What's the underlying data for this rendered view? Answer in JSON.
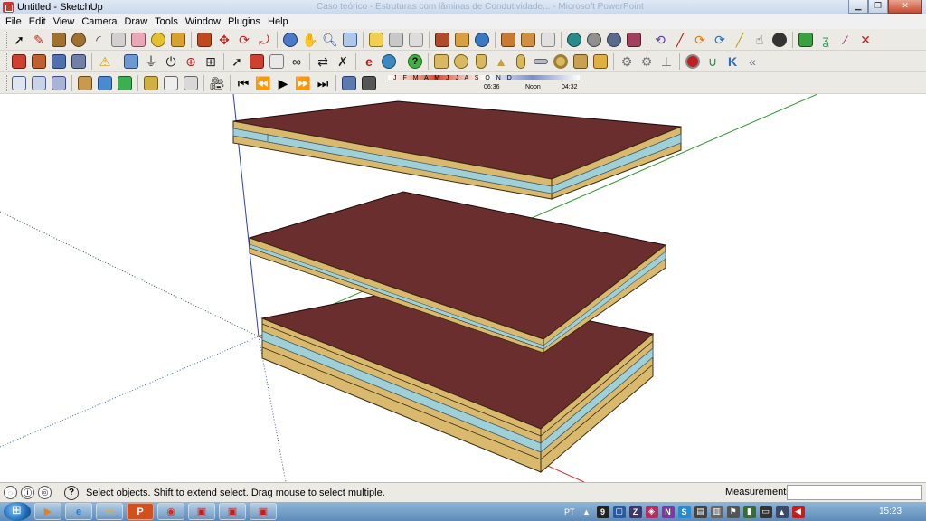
{
  "window": {
    "title": "Untitled - SketchUp",
    "background_title": "Caso teórico - Estruturas com lâminas de Condutividade... - Microsoft PowerPoint",
    "minimize_icon": "minimize-icon",
    "maximize_icon": "restore-icon",
    "close_icon": "close-icon"
  },
  "menu": {
    "items": [
      "File",
      "Edit",
      "View",
      "Camera",
      "Draw",
      "Tools",
      "Window",
      "Plugins",
      "Help"
    ]
  },
  "shadow_settings": {
    "months": "J F M A M J J A S O N D",
    "date_value": "06:36",
    "noon_label": "Noon",
    "time_value": "04:32"
  },
  "status": {
    "message": "Select objects. Shift to extend select. Drag mouse to select multiple.",
    "measurements_label": "Measurements",
    "measurements_value": ""
  },
  "taskbar": {
    "language": "PT",
    "clock": "15:23"
  },
  "model": {
    "face_color": "#6b2e2e",
    "wood_color": "#d9b96e",
    "glass_color": "#9fd0d8",
    "axis_red": "#d0302a",
    "axis_green": "#2f9a2f",
    "axis_blue": "#2a3fb8"
  }
}
